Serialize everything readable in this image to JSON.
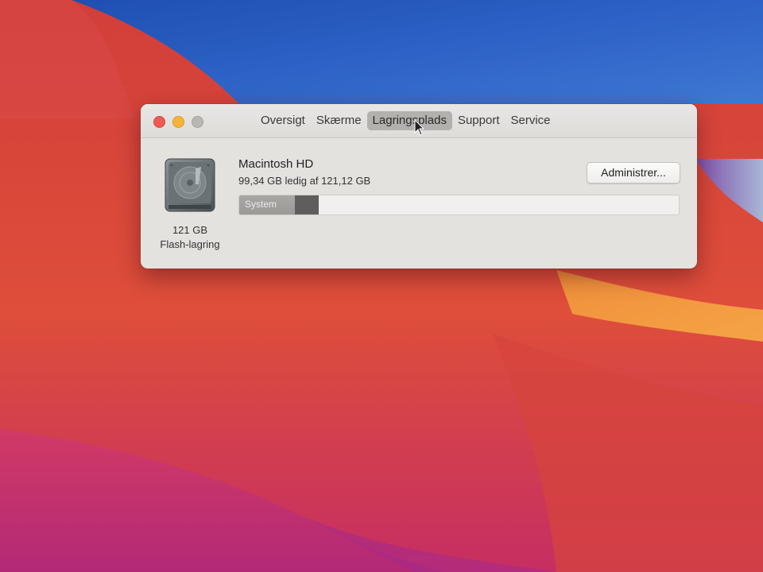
{
  "window": {
    "tabs": [
      {
        "label": "Oversigt",
        "selected": false
      },
      {
        "label": "Skærme",
        "selected": false
      },
      {
        "label": "Lagringsplads",
        "selected": true
      },
      {
        "label": "Support",
        "selected": false
      },
      {
        "label": "Service",
        "selected": false
      }
    ]
  },
  "drive": {
    "size": "121 GB",
    "type": "Flash-lagring",
    "icon": "internal-drive-icon"
  },
  "volume": {
    "name": "Macintosh HD",
    "free_text": "99,34 GB ledig af 121,12 GB",
    "manage_label": "Administrer...",
    "used_fraction": 0.18,
    "segment_label": "System"
  },
  "colors": {
    "close": "#ee5b52",
    "minimize": "#f4b43c",
    "zoom": "#b9b7b4",
    "system_segment": "#a9a7a4",
    "selected_tab": "#b3b1ae"
  }
}
